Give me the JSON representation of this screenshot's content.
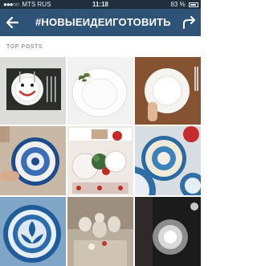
{
  "status_bar": {
    "signal_dots": "●●●○○",
    "carrier": "MTS RUS",
    "time": "11:18",
    "battery": "83 %"
  },
  "nav": {
    "title": "#НОВЫЕИДЕИГОТОВИТЬ",
    "back_icon": "back-arrow-icon",
    "share_icon": "share-arrow-icon"
  },
  "section": {
    "label": "TOP POSTS"
  },
  "posts": [
    {
      "description": "smiley-plate-on-placemat"
    },
    {
      "description": "white-plate-with-sprig"
    },
    {
      "description": "hand-holding-white-plate"
    },
    {
      "description": "blue-patterned-plate"
    },
    {
      "description": "table-setting-red-cups"
    },
    {
      "description": "stacked-blue-plates"
    },
    {
      "description": "blue-floral-platter"
    },
    {
      "description": "ceramic-figurines"
    },
    {
      "description": "glowing-dish"
    }
  ]
}
